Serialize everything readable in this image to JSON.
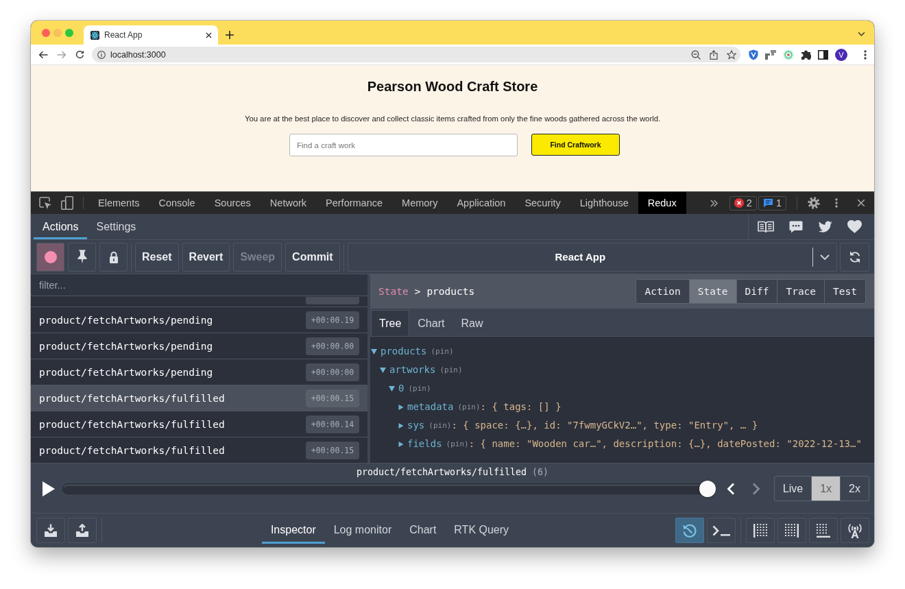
{
  "browser": {
    "tabs": [
      {
        "title": "React App",
        "selected": true
      }
    ],
    "address": "localhost:3000",
    "profile_initial": "V"
  },
  "page": {
    "title": "Pearson Wood Craft Store",
    "intro": "You are at the best place to discover and collect classic items crafted from only the fine woods gathered across the world.",
    "search": {
      "placeholder": "Find a craft work"
    },
    "search_button": "Find Craftwork"
  },
  "devtools": {
    "tabs": [
      {
        "label": "Elements",
        "selected": false
      },
      {
        "label": "Console",
        "selected": false
      },
      {
        "label": "Sources",
        "selected": false
      },
      {
        "label": "Network",
        "selected": false
      },
      {
        "label": "Performance",
        "selected": false
      },
      {
        "label": "Memory",
        "selected": false
      },
      {
        "label": "Application",
        "selected": false
      },
      {
        "label": "Security",
        "selected": false
      },
      {
        "label": "Lighthouse",
        "selected": false
      },
      {
        "label": "Redux",
        "selected": true
      }
    ],
    "badges": [
      {
        "kind": "error",
        "count": "2"
      },
      {
        "kind": "message",
        "count": "1"
      }
    ]
  },
  "redux": {
    "header_tabs": [
      {
        "label": "Actions",
        "selected": true
      },
      {
        "label": "Settings",
        "selected": false
      }
    ],
    "toolbar": {
      "recording": true,
      "buttons": [
        {
          "label": "Reset",
          "disabled": false
        },
        {
          "label": "Revert",
          "disabled": false
        },
        {
          "label": "Sweep",
          "disabled": true
        },
        {
          "label": "Commit",
          "disabled": false
        }
      ],
      "instance": "React App"
    },
    "filter": {
      "placeholder": "filter..."
    },
    "actions": [
      {
        "kind": "partial",
        "selected": false
      },
      {
        "kind": "full",
        "type": "product/fetchArtworks/pending",
        "time": "+00:00.19",
        "selected": false
      },
      {
        "kind": "full",
        "type": "product/fetchArtworks/pending",
        "time": "+00:00.00",
        "selected": false
      },
      {
        "kind": "full",
        "type": "product/fetchArtworks/pending",
        "time": "+00:00:00",
        "selected": false
      },
      {
        "kind": "full",
        "type": "product/fetchArtworks/fulfilled",
        "time": "+00:00.15",
        "selected": true
      },
      {
        "kind": "full",
        "type": "product/fetchArtworks/fulfilled",
        "time": "+00:00.14",
        "selected": false
      },
      {
        "kind": "full",
        "type": "product/fetchArtworks/fulfilled",
        "time": "+00:00.15",
        "selected": false
      }
    ],
    "breadcrumb": {
      "root": "State",
      "separator": ">",
      "path": "products"
    },
    "view_tabs": [
      {
        "label": "Action",
        "selected": false
      },
      {
        "label": "State",
        "selected": true
      },
      {
        "label": "Diff",
        "selected": false
      },
      {
        "label": "Trace",
        "selected": false
      },
      {
        "label": "Test",
        "selected": false
      }
    ],
    "subtabs": [
      {
        "label": "Tree",
        "selected": true
      },
      {
        "label": "Chart",
        "selected": false
      },
      {
        "label": "Raw",
        "selected": false
      }
    ],
    "tree": [
      {
        "key": "products",
        "pin": "(pin)",
        "expanded": true,
        "children": [
          {
            "key": "artworks",
            "pin": "(pin)",
            "expanded": true,
            "children": [
              {
                "key": "0",
                "pin": "(pin)",
                "expanded": true,
                "children": [
                  {
                    "key": "metadata",
                    "pin": "(pin)",
                    "expanded": false,
                    "value": ": { tags: [] }"
                  },
                  {
                    "key": "sys",
                    "pin": "(pin)",
                    "expanded": false,
                    "value": ": { space: {…}, id: \"7fwmyGCkV2…\", type: \"Entry\", … }"
                  },
                  {
                    "key": "fields",
                    "pin": "(pin)",
                    "expanded": false,
                    "value": ": { name: \"Wooden car…\", description: {…}, datePosted: \"2022-12-13…\""
                  }
                ]
              }
            ]
          }
        ]
      }
    ],
    "slider": {
      "label": "product/fetchArtworks/fulfilled",
      "count": "(6)",
      "level": 1,
      "steps": [
        {
          "kind": "prev",
          "disabled": false
        },
        {
          "kind": "next",
          "disabled": true
        }
      ]
    },
    "speed": [
      {
        "label": "Live",
        "selected": false
      },
      {
        "label": "1x",
        "selected": true
      },
      {
        "label": "2x",
        "selected": false
      }
    ],
    "monitors": [
      {
        "label": "Inspector",
        "selected": true
      },
      {
        "label": "Log monitor",
        "selected": false
      },
      {
        "label": "Chart",
        "selected": false
      },
      {
        "label": "RTK Query",
        "selected": false
      }
    ],
    "tools": [
      {
        "kind": "dispatcher",
        "selected": true
      },
      {
        "kind": "terminal",
        "selected": false
      },
      {
        "kind": "dock-left",
        "selected": false
      },
      {
        "kind": "dock-right",
        "selected": false
      },
      {
        "kind": "dock-bottom",
        "selected": false
      },
      {
        "kind": "remote",
        "selected": false
      }
    ]
  }
}
